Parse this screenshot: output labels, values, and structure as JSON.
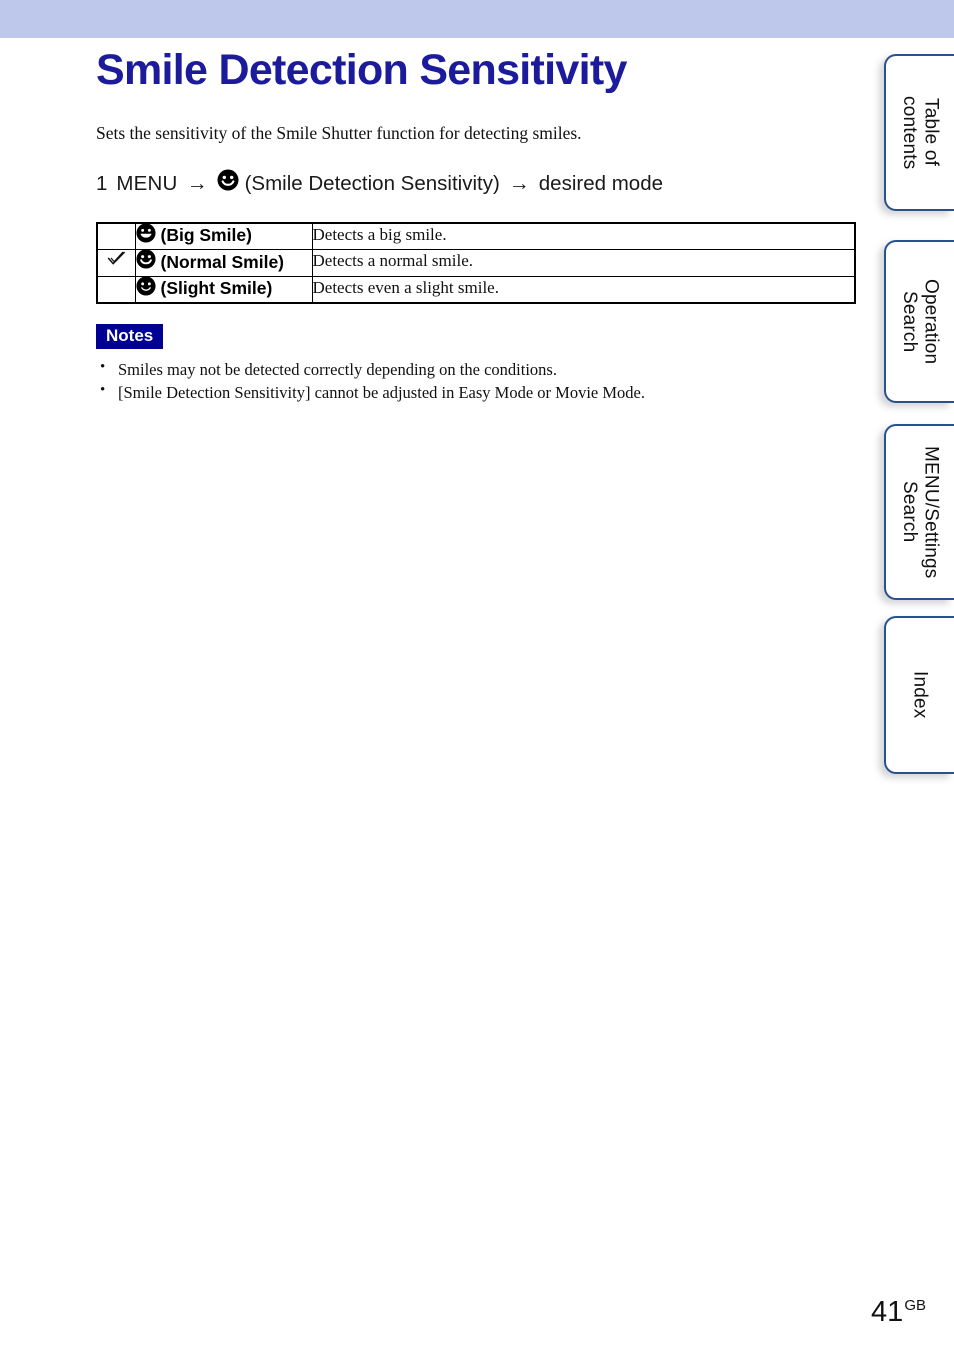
{
  "page": {
    "title": "Smile Detection Sensitivity",
    "intro": "Sets the sensitivity of the Smile Shutter function for detecting smiles.",
    "header_band_color": "#bdc8ea",
    "title_color": "#1b1b9b",
    "number": "41",
    "number_suffix": "GB"
  },
  "step": {
    "number": "1",
    "menu_label": "MENU",
    "arrow": "→",
    "icon": "smiley-normal-icon",
    "function_name": "(Smile Detection Sensitivity)",
    "result": "desired mode"
  },
  "table": {
    "rows": [
      {
        "checked": "",
        "icon": "smiley-big-icon",
        "label": "(Big Smile)",
        "description": "Detects a big smile."
      },
      {
        "checked": "✓",
        "icon": "smiley-normal-icon",
        "label": "(Normal Smile)",
        "description": "Detects a normal smile."
      },
      {
        "checked": "",
        "icon": "smiley-slight-icon",
        "label": "(Slight Smile)",
        "description": "Detects even a slight smile."
      }
    ]
  },
  "notes": {
    "badge": "Notes",
    "badge_color": "#000092",
    "items": [
      "Smiles may not be detected correctly depending on the conditions.",
      "[Smile Detection Sensitivity] cannot be adjusted in Easy Mode or Movie Mode."
    ]
  },
  "side_tabs": {
    "border_color": "#27518f",
    "items": [
      {
        "label": "Table of\ncontents"
      },
      {
        "label": "Operation\nSearch"
      },
      {
        "label": "MENU/Settings\nSearch"
      },
      {
        "label": "Index"
      }
    ]
  }
}
